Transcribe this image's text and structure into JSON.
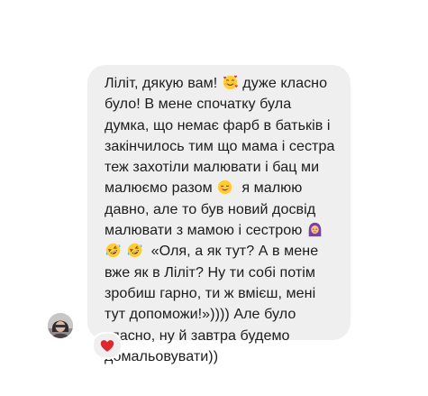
{
  "chat": {
    "message": {
      "segments": [
        "Ліліт, дякую вам! ",
        " дуже класно\nбуло! В мене спочатку була\nдумка, що немає фарб в батьків і\nзакінчилось тим що мама і сестра\nтеж захотіли малювати і бац ми\nмалюємо разом ",
        "  я малюю\nдавно, але то був новий досвід\nмалювати з мамою і сестрою ",
        "\n",
        " ",
        "  «Оля, а як тут? А в мене\nвже як в Ліліт? Ну ти собі потім\nзробиш гарно, ти ж вмієш, мені\nтут допоможи!»)))) Але було\nкласно, ну й завтра будемо\nдомальовувати))"
      ],
      "emojis": [
        "smiling-face-with-hearts-icon",
        "relieved-face-icon",
        "person-with-headscarf-icon",
        "rolling-on-floor-laughing-icon",
        "rolling-on-floor-laughing-icon"
      ]
    },
    "reaction": {
      "icon": "red-heart-icon",
      "color": "#e0262f"
    },
    "colors": {
      "bubble": "#efeff0",
      "text": "#1c1c1c"
    }
  }
}
